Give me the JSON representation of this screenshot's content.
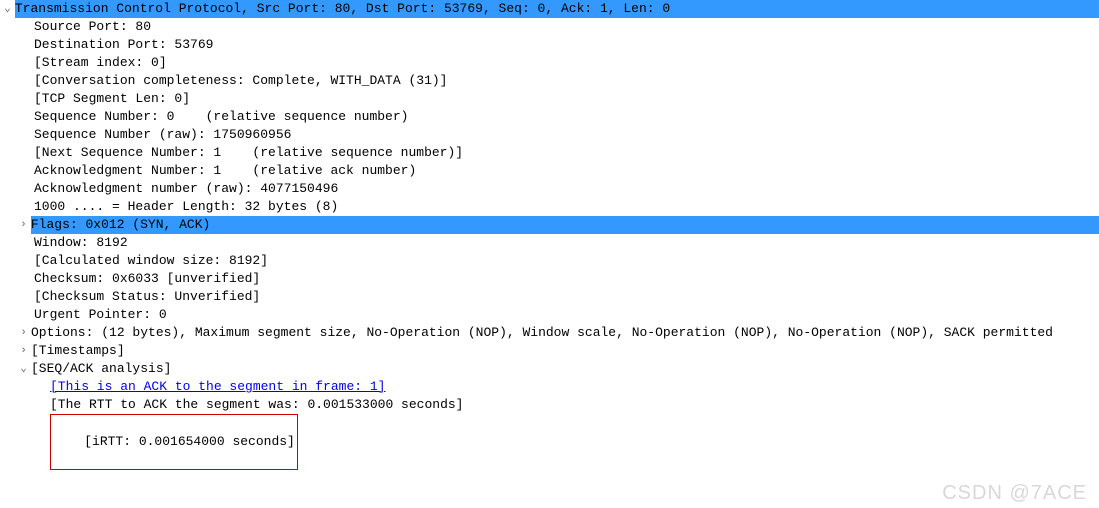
{
  "tcp": {
    "header": "Transmission Control Protocol, Src Port: 80, Dst Port: 53769, Seq: 0, Ack: 1, Len: 0",
    "source_port": "Source Port: 80",
    "dest_port": "Destination Port: 53769",
    "stream_index": "[Stream index: 0]",
    "conv_completeness": "[Conversation completeness: Complete, WITH_DATA (31)]",
    "tcp_seg_len": "[TCP Segment Len: 0]",
    "seq_num": "Sequence Number: 0    (relative sequence number)",
    "seq_num_raw": "Sequence Number (raw): 1750960956",
    "next_seq": "[Next Sequence Number: 1    (relative sequence number)]",
    "ack_num": "Acknowledgment Number: 1    (relative ack number)",
    "ack_num_raw": "Acknowledgment number (raw): 4077150496",
    "header_len": "1000 .... = Header Length: 32 bytes (8)",
    "flags": "Flags: 0x012 (SYN, ACK)",
    "window": "Window: 8192",
    "calc_window": "[Calculated window size: 8192]",
    "checksum": "Checksum: 0x6033 [unverified]",
    "checksum_status": "[Checksum Status: Unverified]",
    "urgent_ptr": "Urgent Pointer: 0",
    "options": "Options: (12 bytes), Maximum segment size, No-Operation (NOP), Window scale, No-Operation (NOP), No-Operation (NOP), SACK permitted",
    "timestamps": "[Timestamps]",
    "seq_ack_analysis": "[SEQ/ACK analysis]",
    "ack_link": "[This is an ACK to the segment in frame: 1]",
    "rtt_to_ack": "[The RTT to ACK the segment was: 0.001533000 seconds]",
    "irtt": "[iRTT: 0.001654000 seconds]"
  },
  "glyphs": {
    "expanded": "⌄",
    "collapsed": "›"
  },
  "watermark": "CSDN @7ACE"
}
